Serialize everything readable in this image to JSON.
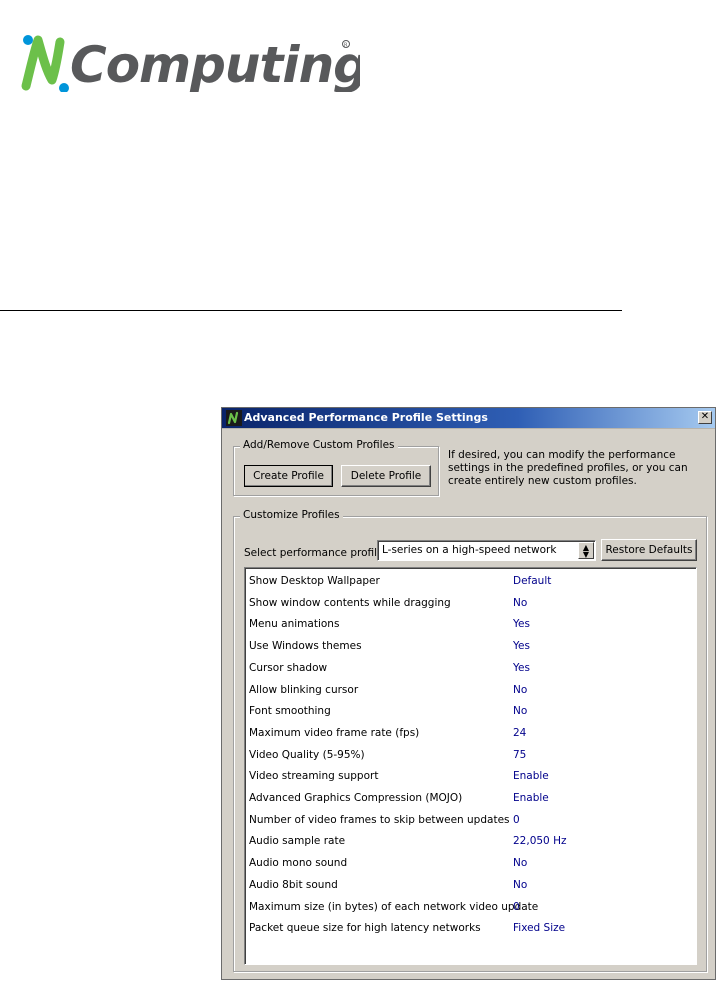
{
  "logo": {
    "text": "NComputing"
  },
  "dialog": {
    "title": "Advanced Performance Profile Settings",
    "close_label": "✕",
    "add_remove_group": {
      "legend": "Add/Remove Custom Profiles",
      "create_label": "Create Profile",
      "delete_label": "Delete Profile"
    },
    "info_text": "If desired, you can modify the performance settings in the predefined profiles, or you can create entirely new custom profiles.",
    "customize_group": {
      "legend": "Customize Profiles",
      "select_label": "Select performance profile:",
      "selected_profile": "L-series on a high-speed network",
      "restore_label": "Restore Defaults"
    },
    "settings": [
      {
        "name": "Show Desktop Wallpaper",
        "value": "Default"
      },
      {
        "name": "Show window contents while dragging",
        "value": "No"
      },
      {
        "name": "Menu animations",
        "value": "Yes"
      },
      {
        "name": "Use Windows themes",
        "value": "Yes"
      },
      {
        "name": "Cursor shadow",
        "value": "Yes"
      },
      {
        "name": "Allow blinking cursor",
        "value": "No"
      },
      {
        "name": "Font smoothing",
        "value": "No"
      },
      {
        "name": "Maximum video frame rate (fps)",
        "value": "24"
      },
      {
        "name": "Video Quality (5-95%)",
        "value": "75"
      },
      {
        "name": "Video streaming support",
        "value": "Enable"
      },
      {
        "name": "Advanced Graphics Compression (MOJO)",
        "value": "Enable"
      },
      {
        "name": "Number of video frames to skip between updates",
        "value": "0"
      },
      {
        "name": "Audio sample rate",
        "value": "22,050 Hz"
      },
      {
        "name": "Audio mono sound",
        "value": "No"
      },
      {
        "name": "Audio 8bit sound",
        "value": "No"
      },
      {
        "name": "Maximum size (in bytes) of each network video update",
        "value": "0"
      },
      {
        "name": "Packet queue size for high latency networks",
        "value": "Fixed Size"
      }
    ]
  },
  "colors": {
    "logo_green": "#6cc04a",
    "logo_blue": "#0095da",
    "logo_gray": "#58595b",
    "value_text": "#00008b"
  }
}
